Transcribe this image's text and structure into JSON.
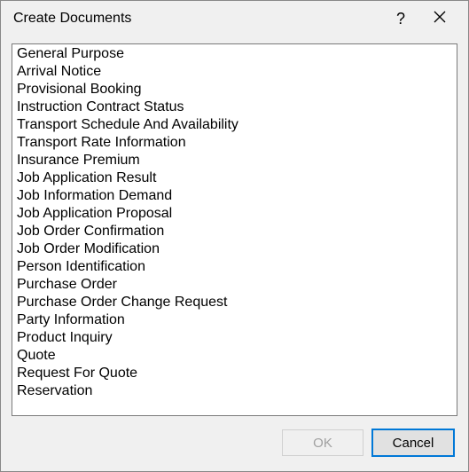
{
  "dialog": {
    "title": "Create Documents"
  },
  "list": {
    "items": [
      "General Purpose",
      "Arrival Notice",
      "Provisional Booking",
      "Instruction Contract Status",
      "Transport Schedule And Availability",
      "Transport Rate Information",
      "Insurance Premium",
      "Job Application Result",
      "Job Information Demand",
      "Job Application Proposal",
      "Job Order Confirmation",
      "Job Order Modification",
      "Person Identification",
      "Purchase Order",
      "Purchase Order Change Request",
      "Party Information",
      "Product Inquiry",
      "Quote",
      "Request For Quote",
      "Reservation"
    ]
  },
  "buttons": {
    "ok": "OK",
    "cancel": "Cancel"
  }
}
